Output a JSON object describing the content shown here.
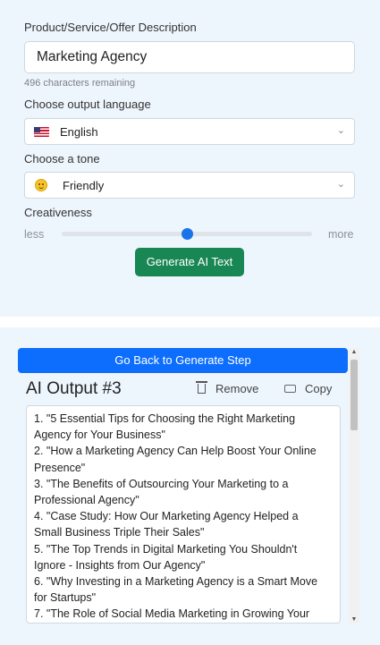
{
  "form": {
    "description_label": "Product/Service/Offer Description",
    "description_value": "Marketing Agency",
    "chars_remaining": "496 characters remaining",
    "language_label": "Choose output language",
    "language_value": "English",
    "tone_label": "Choose a tone",
    "tone_value": "Friendly",
    "creativeness_label": "Creativeness",
    "range_min_label": "less",
    "range_max_label": "more",
    "creativeness_level": 0.5,
    "generate_button": "Generate AI Text"
  },
  "output": {
    "back_button": "Go Back to Generate Step",
    "title": "AI Output #3",
    "remove_label": "Remove",
    "copy_label": "Copy",
    "lines": [
      "1. \"5 Essential Tips for Choosing the Right Marketing",
      "Agency for Your Business\"",
      "2. \"How a Marketing Agency Can Help Boost Your Online",
      "Presence\"",
      "3. \"The Benefits of Outsourcing Your Marketing to a",
      "Professional Agency\"",
      "4. \"Case Study: How Our Marketing Agency Helped a",
      "Small Business Triple Their Sales\"",
      "5. \"The Top Trends in Digital Marketing You Shouldn't",
      "Ignore - Insights from Our Agency\"",
      "6. \"Why Investing in a Marketing Agency is a Smart Move",
      "for Startups\"",
      "7. \"The Role of Social Media Marketing in Growing Your"
    ]
  },
  "colors": {
    "panel_bg": "#eef6fd",
    "generate_button": "#198754",
    "back_button": "#0d6efd",
    "slider_thumb": "#1a73e8"
  },
  "icons": {
    "language_icon": "us-flag-icon",
    "tone_icon": "smiley-icon",
    "remove_icon": "trash-icon",
    "copy_icon": "keyboard-icon",
    "select_chevron": "chevron-down-icon"
  }
}
